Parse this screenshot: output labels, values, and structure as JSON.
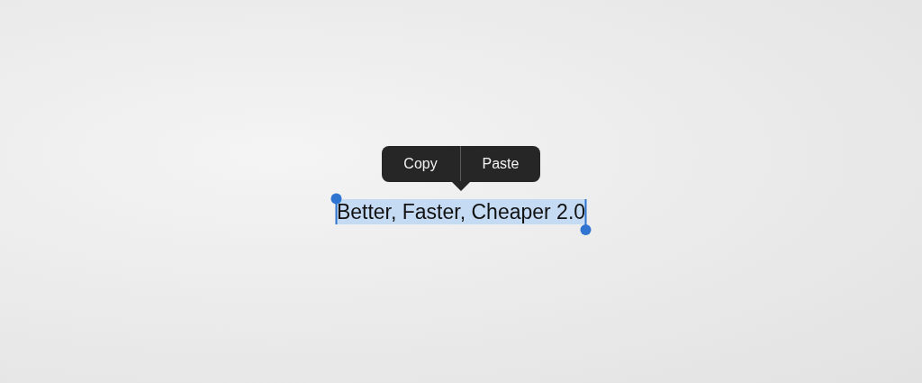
{
  "edit_menu": {
    "items": [
      {
        "label": "Copy"
      },
      {
        "label": "Paste"
      }
    ]
  },
  "text": {
    "value": "Better, Faster, Cheaper 2.0",
    "selected": true
  }
}
